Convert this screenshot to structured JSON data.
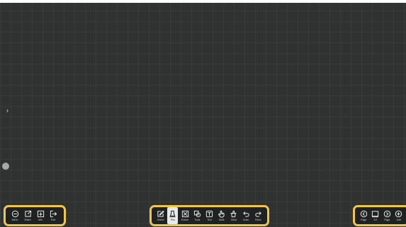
{
  "left_toolbar": {
    "items": [
      {
        "label": "Menu",
        "icon": "minus-circle-icon"
      },
      {
        "label": "Share",
        "icon": "share-icon"
      },
      {
        "label": "Min",
        "icon": "minimize-icon"
      },
      {
        "label": "Exit",
        "icon": "exit-icon"
      }
    ]
  },
  "center_toolbar": {
    "items": [
      {
        "label": "Select",
        "icon": "select-icon"
      },
      {
        "label": "Pen",
        "icon": "pen-icon",
        "active": true
      },
      {
        "label": "Eraser",
        "icon": "eraser-icon"
      },
      {
        "label": "Tools",
        "icon": "tools-icon"
      },
      {
        "label": "Text",
        "icon": "text-icon"
      },
      {
        "label": "Multi",
        "icon": "multi-touch-icon"
      },
      {
        "label": "Clear",
        "icon": "clear-icon"
      },
      {
        "label": "Undo",
        "icon": "undo-icon"
      },
      {
        "label": "Redo",
        "icon": "redo-icon"
      }
    ]
  },
  "right_toolbar": {
    "items": [
      {
        "label": "Page",
        "icon": "prev-page-icon"
      },
      {
        "label": "1/2",
        "icon": "page-icon"
      },
      {
        "label": "Page",
        "icon": "next-page-icon"
      },
      {
        "label": "Add",
        "icon": "add-page-icon"
      }
    ]
  },
  "colors": {
    "canvas": "#2f3231",
    "toolbar_bg": "#202221",
    "toolbar_border": "#f0c64a",
    "active_tool_bg": "#e9e9e9"
  }
}
